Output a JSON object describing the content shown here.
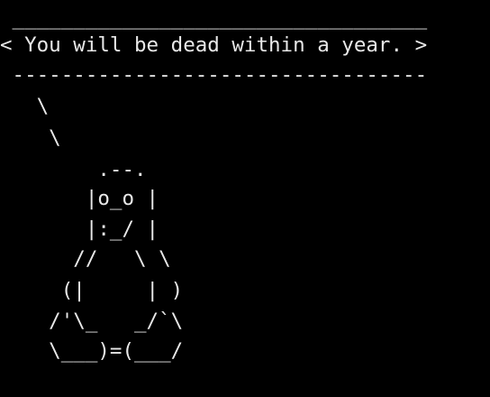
{
  "terminal": {
    "background": "#000000",
    "foreground": "#e8e8e8",
    "bubble": {
      "top_border": " __________________________________",
      "text": "< You will be dead within a year. >",
      "bottom_border": " ----------------------------------"
    },
    "tux": [
      "   \\",
      "    \\",
      "        .--.",
      "       |o_o |",
      "       |:_/ |",
      "      //   \\ \\",
      "     (|     | )",
      "    /'\\_   _/`\\",
      "    \\___)=(___/"
    ]
  }
}
